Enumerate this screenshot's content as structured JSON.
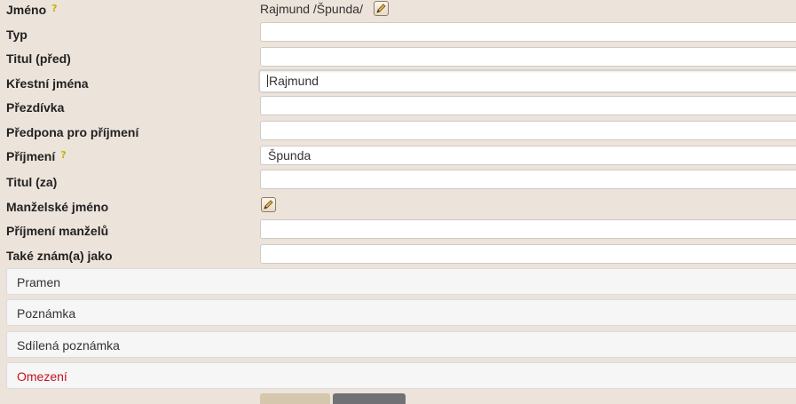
{
  "rows": {
    "jmeno": {
      "label": "Jméno",
      "value": "Rajmund /Špunda/"
    },
    "typ": {
      "label": "Typ",
      "value": ""
    },
    "titul_pred": {
      "label": "Titul (před)",
      "value": ""
    },
    "krestni": {
      "label": "Křestní jména",
      "value": "Rajmund"
    },
    "prezdivka": {
      "label": "Přezdívka",
      "value": ""
    },
    "predpona": {
      "label": "Předpona pro příjmení",
      "value": ""
    },
    "prijmeni": {
      "label": "Příjmení",
      "value": "Špunda"
    },
    "titul_za": {
      "label": "Titul (za)",
      "value": ""
    },
    "manzelske": {
      "label": "Manželské jméno"
    },
    "prijmeni_manzelu": {
      "label": "Příjmení manželů",
      "value": ""
    },
    "take_znam": {
      "label": "Také znám(a) jako",
      "value": ""
    }
  },
  "sections": {
    "pramen": "Pramen",
    "poznamka": "Poznámka",
    "sdilena": "Sdílená poznámka",
    "omezeni": "Omezení"
  },
  "icons": {
    "help": "help-icon",
    "edit": "edit-pencil-icon"
  },
  "colors": {
    "background": "#ece3db",
    "restriction_text": "#c1121f",
    "button_primary": "#d4c7ad",
    "button_secondary": "#707174"
  }
}
